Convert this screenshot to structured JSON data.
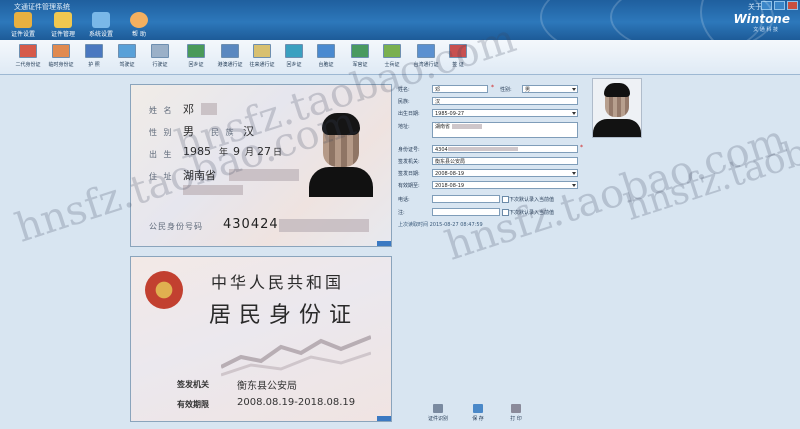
{
  "titlebar": {
    "app_title": "文通证件管理系统",
    "help": "关于"
  },
  "main_tabs": [
    {
      "label": "证件设置",
      "icon": "id-settings-icon",
      "color": "#e8b040"
    },
    {
      "label": "证件管理",
      "icon": "folder-icon",
      "color": "#f0c850"
    },
    {
      "label": "系统设置",
      "icon": "house-icon",
      "color": "#7ab8e8"
    },
    {
      "label": "帮 助",
      "icon": "help-user-icon",
      "color": "#f3b060"
    }
  ],
  "logo": {
    "text": "Wintone",
    "sub": "文 通 科 技"
  },
  "toolbar": [
    {
      "label": "二代身份证",
      "icon": "id-card-icon",
      "color": "#d65a4a"
    },
    {
      "label": "临时身份证",
      "icon": "temp-id-icon",
      "color": "#e08a50"
    },
    {
      "label": "护 照",
      "icon": "passport-icon",
      "color": "#4a78c0"
    },
    {
      "label": "驾驶证",
      "icon": "driver-license-icon",
      "color": "#58a0d8"
    },
    {
      "label": "行驶证",
      "icon": "vehicle-license-icon",
      "color": "#9ab0c8"
    },
    {
      "label": "回乡证",
      "icon": "return-permit-icon",
      "color": "#4a9a5a"
    },
    {
      "label": "港澳通行证",
      "icon": "hk-macau-permit-icon",
      "color": "#5a88c0"
    },
    {
      "label": "往来通行证",
      "icon": "travel-permit-icon",
      "color": "#d8c070"
    },
    {
      "label": "回乡证",
      "icon": "home-return-icon",
      "color": "#3aa0c0"
    },
    {
      "label": "台胞证",
      "icon": "taiwan-permit-icon",
      "color": "#4a8ad0"
    },
    {
      "label": "军官证",
      "icon": "officer-id-icon",
      "color": "#4a9a60"
    },
    {
      "label": "士兵证",
      "icon": "soldier-id-icon",
      "color": "#7ab050"
    },
    {
      "label": "台湾通行证",
      "icon": "taiwan-pass-icon",
      "color": "#5a90d0"
    },
    {
      "label": "签 证",
      "icon": "visa-icon",
      "color": "#c85050"
    }
  ],
  "id_front": {
    "name_label": "姓 名",
    "name_value": "邓",
    "sex_label": "性 别",
    "sex_value": "男",
    "ethnic_label": "民 族",
    "ethnic_value": "汉",
    "birth_label": "出 生",
    "birth_year": "1985",
    "birth_year_unit": "年",
    "birth_month": "9",
    "birth_month_unit": "月",
    "birth_day": "27",
    "birth_day_unit": "日",
    "addr_label": "住 址",
    "addr_value": "湖南省",
    "idnum_label": "公民身份号码",
    "idnum_value": "430424"
  },
  "id_back": {
    "title1": "中华人民共和国",
    "title2": "居民身份证",
    "authority_label": "签发机关",
    "authority_value": "衡东县公安局",
    "valid_label": "有效期限",
    "valid_value": "2008.08.19-2018.08.19"
  },
  "watermarks": [
    "hnsfz.taobao.com",
    "hnsfz.taobao.com",
    "hnsfz.taobao.com",
    "hnsfz.taobao.com"
  ],
  "form": {
    "name_label": "姓名:",
    "name_value": "邓",
    "sex_label": "性别:",
    "sex_value": "男",
    "ethnic_label": "民族:",
    "ethnic_value": "汉",
    "birth_label": "出生日期:",
    "birth_value": "1985-09-27",
    "addr_label": "地址:",
    "addr_value": "湖南省",
    "idnum_label": "身份证号:",
    "idnum_value": "4304",
    "authority_label": "签发机关:",
    "authority_value": "衡东县公安局",
    "issue_label": "签发日期:",
    "issue_value": "2008-08-19",
    "valid_label": "有效期至:",
    "valid_value": "2018-08-19",
    "phone_label": "电话:",
    "phone_value": "",
    "note_label": "注:",
    "note_value": "",
    "chk1_label": "下次默认录入当前值",
    "chk2_label": "下次默认录入当前值",
    "last_read": "上次读取时间 2015-08-27 08:47:59",
    "required_mark": "*"
  },
  "bottom_buttons": [
    {
      "label": "证件识别",
      "icon": "scan-icon",
      "color": "#7a8aa0"
    },
    {
      "label": "保 存",
      "icon": "save-icon",
      "color": "#4a88c8"
    },
    {
      "label": "打 印",
      "icon": "print-icon",
      "color": "#8a8a9a"
    }
  ]
}
